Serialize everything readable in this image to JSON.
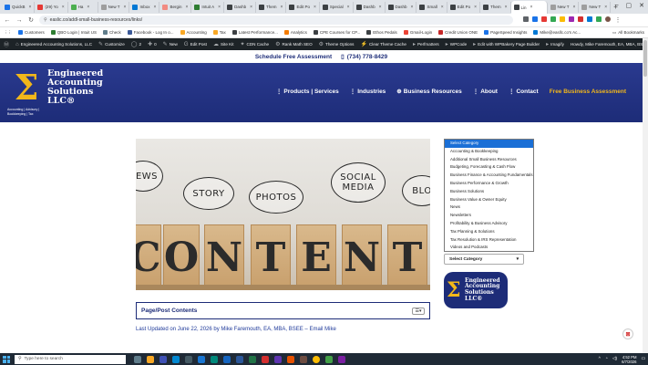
{
  "browser": {
    "tabs": [
      {
        "label": "QuickB",
        "color": "#1a73e8"
      },
      {
        "label": "(29) Yo",
        "color": "#e53935"
      },
      {
        "label": "Ha",
        "color": "#4caf50"
      },
      {
        "label": "New T",
        "color": "#9e9e9e"
      },
      {
        "label": "Inbox",
        "color": "#0078d4"
      },
      {
        "label": "Bergin",
        "color": "#f28b82"
      },
      {
        "label": "Intuit A",
        "color": "#2e7d32"
      },
      {
        "label": "Dashb",
        "color": "#3c4043"
      },
      {
        "label": "Them",
        "color": "#3c4043"
      },
      {
        "label": "Edit Po",
        "color": "#3c4043"
      },
      {
        "label": "Special",
        "color": "#3c4043"
      },
      {
        "label": "Dashb",
        "color": "#3c4043"
      },
      {
        "label": "Dashb",
        "color": "#3c4043"
      },
      {
        "label": "Small",
        "color": "#3c4043"
      },
      {
        "label": "Edit Po",
        "color": "#3c4043"
      },
      {
        "label": "Them",
        "color": "#3c4043"
      },
      {
        "label": "Lin",
        "color": "#3c4043",
        "active": true
      },
      {
        "label": "New T",
        "color": "#9e9e9e"
      },
      {
        "label": "New T",
        "color": "#9e9e9e"
      }
    ],
    "url": "easlic.co/addl-small-business-resources/links/"
  },
  "bookmarks": {
    "items": [
      "Customers",
      "QBO Login | Intuit US",
      "Check",
      "Facebook - Log In o...",
      "Accounting",
      "Tax",
      "Latest Performance...",
      "Analytics",
      "CPE Courses for CP...",
      "Ethos Pedals",
      "Gmail-Login",
      "Credit Union ONE",
      "PageSpeed Insights",
      "Mike@easllc.co's Ac..."
    ],
    "all_label": "All Bookmarks"
  },
  "wp_admin": {
    "items": [
      "Engineered Accounting Solutions, LLC",
      "Customize",
      "2",
      "0",
      "New",
      "Edit Post",
      "Site Kit",
      "CDN Cache",
      "Rank Math SEO",
      "Theme Options",
      "Clear Theme Cache",
      "Perfmatters",
      "WPCode",
      "Edit with WPBakery Page Builder",
      "Imagify"
    ],
    "howdy": "Howdy, Mike Faremouth, EA, MBA, BSEE"
  },
  "schedule": {
    "label": "Schedule Free Assessment",
    "phone": "(734) 778-8429"
  },
  "site": {
    "logo_lines": [
      "Engineered",
      "Accounting",
      "Solutions",
      "LLC®"
    ],
    "logo_tagline": "Accounting | Advisory | Bookkeeping | Tax",
    "nav": [
      "Products | Services",
      "Industries",
      "Business Resources",
      "About",
      "Contact"
    ],
    "cta": "Free Business Assessment"
  },
  "hero": {
    "bubbles": [
      "NEWS",
      "STORY",
      "PHOTOS",
      "SOCIAL MEDIA",
      "BLO"
    ],
    "blocks": [
      "C",
      "O",
      "N",
      "T",
      "E",
      "N",
      "T"
    ]
  },
  "sidebar": {
    "categories": [
      "Select Category",
      "Accounting & Bookkeeping",
      "Additional Small Business Resources",
      "Budgeting, Forecasting & Cash Flow",
      "Business Finance & Accounting Fundamentals",
      "Business Performance & Growth",
      "Business Solutions",
      "Business Value & Owner Equity",
      "News",
      "Newsletters",
      "Profitability & Business Advisory",
      "Tax Planning & Solutions",
      "Tax Resolution & IRS Representation",
      "Videos and Podcasts"
    ],
    "selected_label": "Select Category",
    "logo_lines": [
      "Engineered",
      "Accounting",
      "Solutions",
      "LLC®"
    ]
  },
  "toc": {
    "title": "Page/Post Contents"
  },
  "updated_text": "Last Updated on June 22, 2026 by Mike Faremouth, EA, MBA, BSEE – Email Mike",
  "taskbar": {
    "search_placeholder": "Type here to search",
    "time": "4:52 PM",
    "date": "6/7/2026"
  }
}
